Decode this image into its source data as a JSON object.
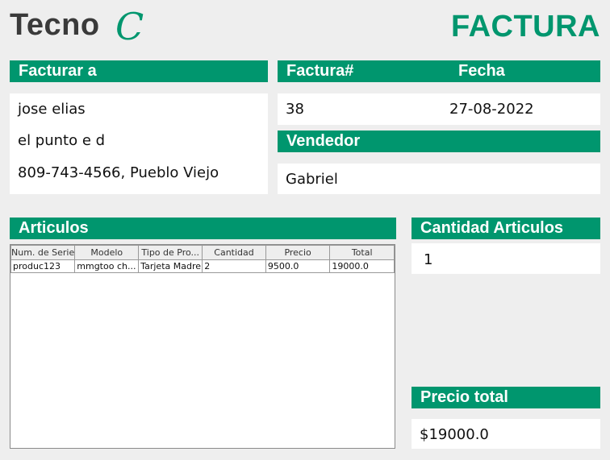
{
  "brand": {
    "name": "Tecno",
    "mark": "C"
  },
  "document_title": "FACTURA",
  "bill_to": {
    "header": "Facturar a",
    "name": "jose elias",
    "address": "el punto e d",
    "contact": "809-743-4566, Pueblo Viejo"
  },
  "invoice": {
    "number_header": "Factura#",
    "date_header": "Fecha",
    "number": "38",
    "date": "27-08-2022"
  },
  "seller": {
    "header": "Vendedor",
    "name": "Gabriel"
  },
  "articles": {
    "header": "Articulos",
    "columns": [
      "Num. de Serie",
      "Modelo",
      "Tipo de Pro...",
      "Cantidad",
      "Precio",
      "Total"
    ],
    "rows": [
      [
        "produc123",
        "mmgtoo ch...",
        "Tarjeta Madre",
        "2",
        "9500.0",
        "19000.0"
      ]
    ]
  },
  "quantity": {
    "header": "Cantidad Articulos",
    "value": "1"
  },
  "total": {
    "header": "Precio total",
    "value": "$19000.0"
  },
  "colors": {
    "accent": "#00966e",
    "background": "#eeeeee",
    "panel": "#ffffff",
    "brand_text": "#3a3a3a"
  }
}
